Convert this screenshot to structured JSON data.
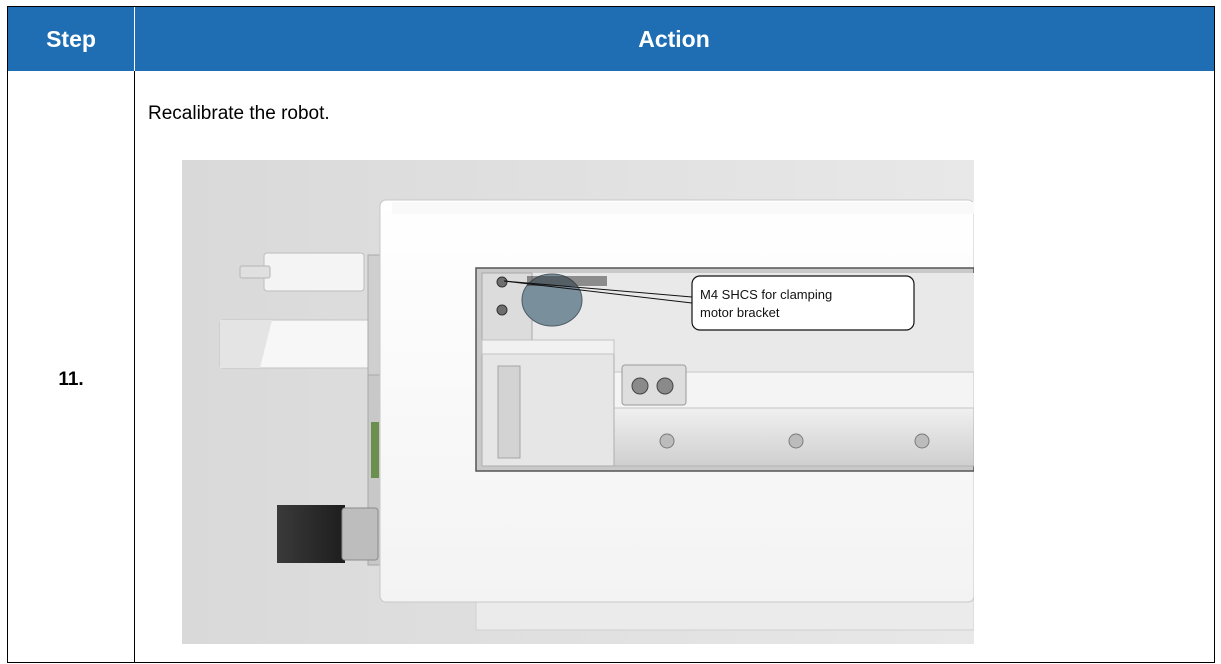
{
  "header": {
    "step_label": "Step",
    "action_label": "Action",
    "background_color": "#1f6db2"
  },
  "row": {
    "step_number": "11.",
    "instruction": "Recalibrate the robot.",
    "figure": {
      "callout_line1": "M4 SHCS for clamping",
      "callout_line2": "motor bracket"
    }
  }
}
